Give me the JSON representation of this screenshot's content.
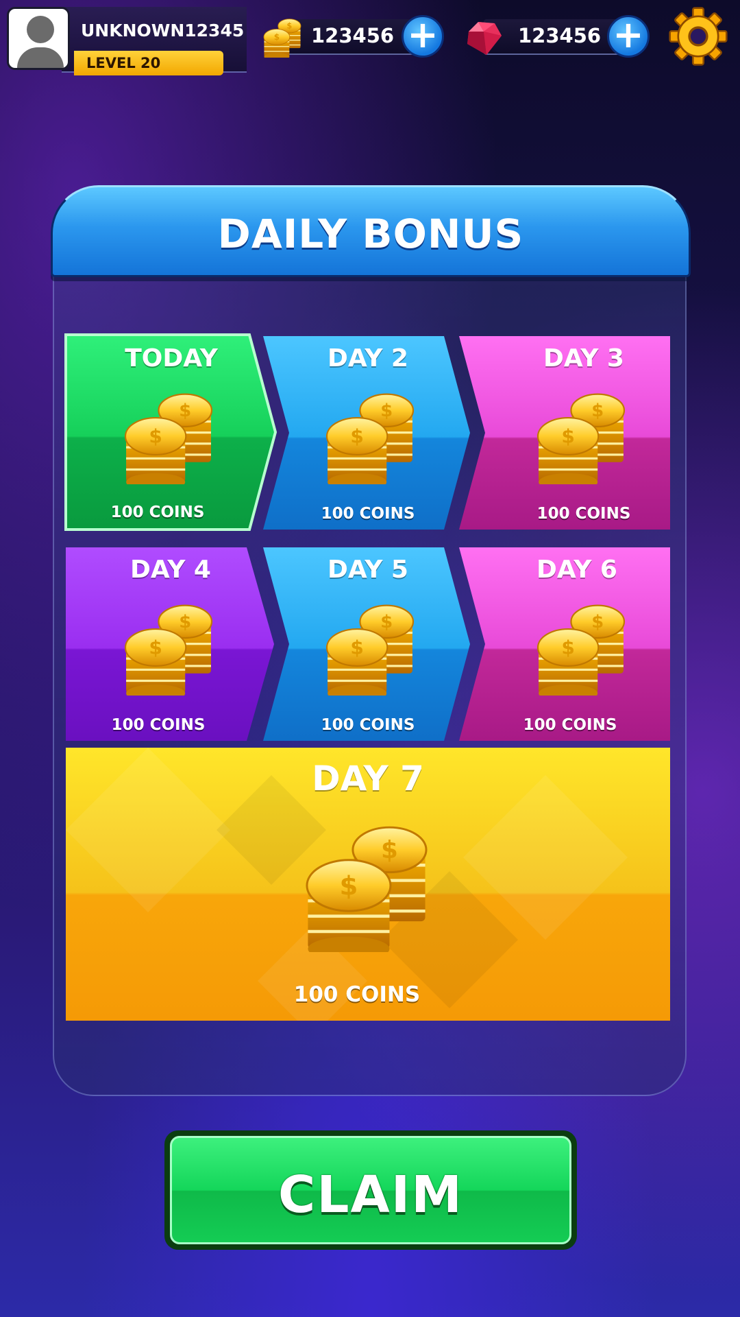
{
  "player": {
    "username": "UNKNOWN12345",
    "level": "LEVEL 20"
  },
  "currencies": {
    "coins": {
      "amount": "123456",
      "icon": "coin-stack-icon"
    },
    "gems": {
      "amount": "123456",
      "icon": "ruby-gem-icon"
    },
    "add_icon": "plus-icon"
  },
  "settings": {
    "icon": "gear-icon"
  },
  "panel": {
    "title": "DAILY BONUS"
  },
  "days": [
    {
      "label": "TODAY",
      "reward": "100 COINS",
      "color": "#1ecf5a"
    },
    {
      "label": "DAY 2",
      "reward": "100 COINS",
      "color": "#22a6ec"
    },
    {
      "label": "DAY 3",
      "reward": "100 COINS",
      "color": "#e04cd6"
    },
    {
      "label": "DAY 4",
      "reward": "100 COINS",
      "color": "#8a1fe0"
    },
    {
      "label": "DAY 5",
      "reward": "100 COINS",
      "color": "#22a6ec"
    },
    {
      "label": "DAY 6",
      "reward": "100 COINS",
      "color": "#e04cd6"
    },
    {
      "label": "DAY 7",
      "reward": "100 COINS",
      "color": "#f5c21a"
    }
  ],
  "claim": {
    "label": "CLAIM"
  },
  "colors": {
    "accent_blue": "#2b97ee",
    "claim_green": "#14d65a",
    "gold": "#f5c21a"
  }
}
